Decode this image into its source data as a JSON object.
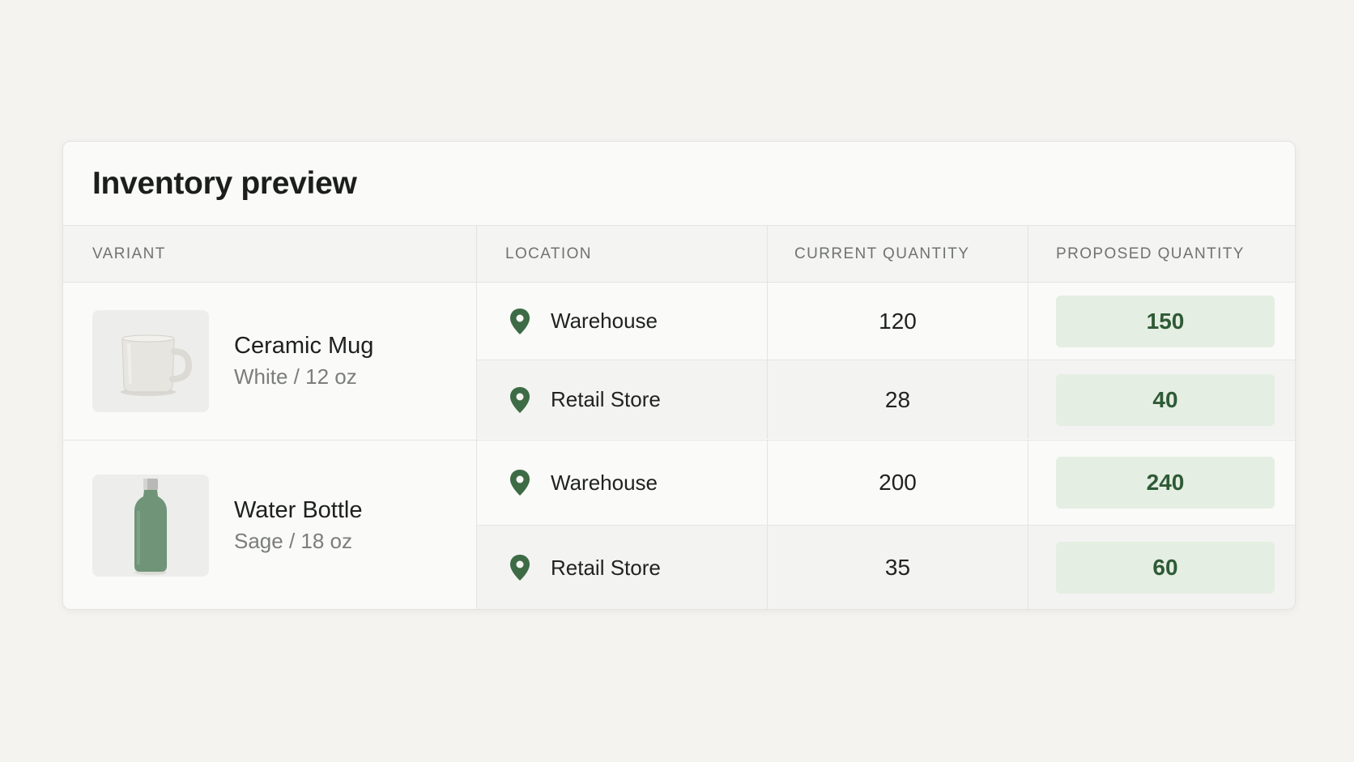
{
  "card": {
    "title": "Inventory preview"
  },
  "columns": {
    "variant": "VARIANT",
    "location": "LOCATION",
    "current": "CURRENT QUANTITY",
    "proposed": "PROPOSED QUANTITY"
  },
  "products": [
    {
      "name": "Ceramic Mug",
      "option": "White / 12 oz",
      "image_icon": "mug-image",
      "locations": [
        {
          "name": "Warehouse",
          "current": "120",
          "proposed": "150"
        },
        {
          "name": "Retail Store",
          "current": "28",
          "proposed": "40"
        }
      ]
    },
    {
      "name": "Water Bottle",
      "option": "Sage / 18 oz",
      "image_icon": "bottle-image",
      "locations": [
        {
          "name": "Warehouse",
          "current": "200",
          "proposed": "240"
        },
        {
          "name": "Retail Store",
          "current": "35",
          "proposed": "60"
        }
      ]
    }
  ],
  "colors": {
    "pin": "#3d6b45",
    "proposed_bg": "#e4eee2",
    "proposed_text": "#2f5a36",
    "bottle": "#6f9477"
  }
}
